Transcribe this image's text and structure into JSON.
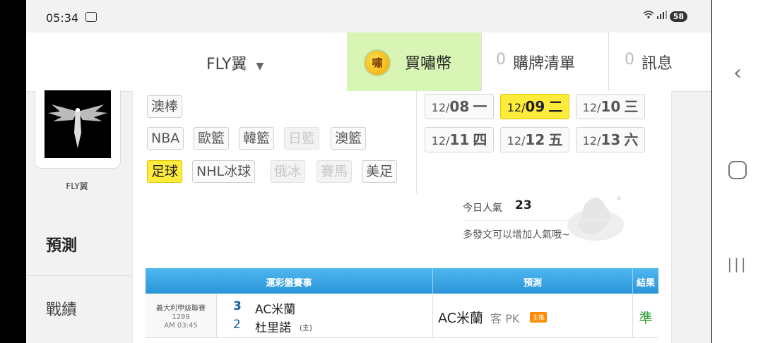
{
  "status_bar": {
    "time": "05:34",
    "battery": "58"
  },
  "header": {
    "username": "FLY翼",
    "buy_coin_label": "買嘯幣",
    "coin_icon_text": "嘯",
    "cart_count": "0",
    "cart_label": "購牌清單",
    "msg_count": "0",
    "msg_label": "訊息"
  },
  "sidebar": {
    "username": "FLY翼",
    "tabs": [
      {
        "label": "預測",
        "active": true
      },
      {
        "label": "戰績",
        "active": false
      }
    ]
  },
  "categories": [
    {
      "label": "澳棒",
      "state": "normal"
    },
    {
      "label": "NBA",
      "state": "normal"
    },
    {
      "label": "歐籃",
      "state": "normal"
    },
    {
      "label": "韓籃",
      "state": "normal"
    },
    {
      "label": "日籃",
      "state": "disabled"
    },
    {
      "label": "澳籃",
      "state": "normal"
    },
    {
      "label": "足球",
      "state": "selected"
    },
    {
      "label": "NHL冰球",
      "state": "normal"
    },
    {
      "label": "俄冰",
      "state": "disabled"
    },
    {
      "label": "賽馬",
      "state": "disabled"
    },
    {
      "label": "美足",
      "state": "normal"
    }
  ],
  "dates": [
    {
      "md": "12/",
      "d": "08",
      "wd": "一"
    },
    {
      "md": "12/",
      "d": "09",
      "wd": "二",
      "selected": true
    },
    {
      "md": "12/",
      "d": "10",
      "wd": "三"
    },
    {
      "md": "12/",
      "d": "11",
      "wd": "四"
    },
    {
      "md": "12/",
      "d": "12",
      "wd": "五"
    },
    {
      "md": "12/",
      "d": "13",
      "wd": "六"
    }
  ],
  "popularity": {
    "label": "今日人氣",
    "value": "23",
    "hint": "多發文可以增加人氣哦~"
  },
  "table": {
    "headers": {
      "event": "運彩盤賽事",
      "prediction": "預測",
      "result": "結果"
    },
    "rows": [
      {
        "league": "義大利甲級聯賽",
        "game_no": "1299",
        "time": "AM 03:45",
        "away_score": "3",
        "away_team": "AC米蘭",
        "home_score": "2",
        "home_team": "杜里諾",
        "home_tag": "(主)",
        "pick_team": "AC米蘭",
        "pick_type": "客 PK",
        "badge": "主推",
        "result": "準"
      }
    ]
  },
  "colors": {
    "accent_blue": "#2b95d9",
    "highlight_yellow": "#ffeb3b",
    "buy_green": "#d9f5b5",
    "win_green": "#2e9e2e",
    "badge_orange": "#ff8a00"
  }
}
